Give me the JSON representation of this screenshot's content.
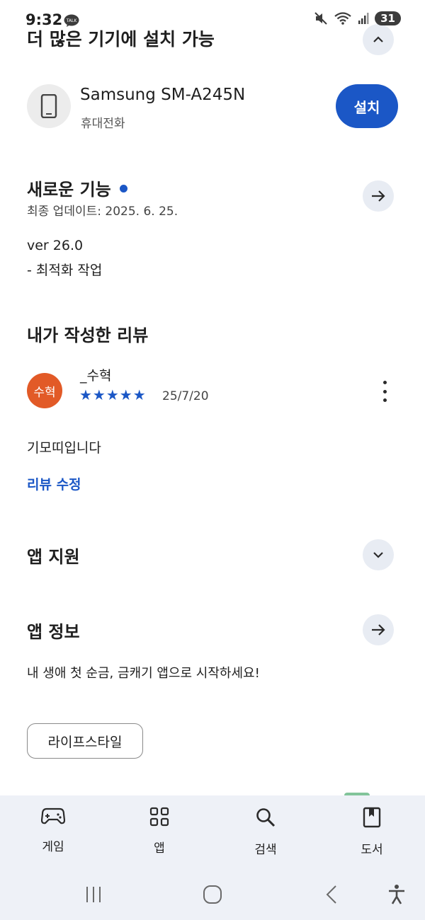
{
  "status_bar": {
    "time": "9:32",
    "talk_badge": "TALK",
    "battery": "31"
  },
  "header": {
    "cut_title": "더 많은 기기에 설치 가능"
  },
  "device": {
    "name": "Samsung SM-A245N",
    "type": "휴대전화",
    "install_label": "설치"
  },
  "whats_new": {
    "title": "새로운 기능",
    "updated": "최종 업데이트: 2025. 6. 25.",
    "version": "ver 26.0",
    "note": "- 최적화 작업"
  },
  "my_review": {
    "title": "내가 작성한 리뷰",
    "avatar_text": "수혁",
    "reviewer": "_수혁",
    "rating": 5,
    "stars": "★★★★★",
    "date": "25/7/20",
    "text": "기모띠입니다",
    "edit_label": "리뷰 수정"
  },
  "app_support": {
    "title": "앱 지원"
  },
  "app_info": {
    "title": "앱 정보",
    "description": "내 생애 첫 순금, 금캐기 앱으로 시작하세요!",
    "category_chip": "라이프스타일"
  },
  "bottom_nav": {
    "items": [
      {
        "label": "게임",
        "icon": "gamepad-icon"
      },
      {
        "label": "앱",
        "icon": "apps-grid-icon"
      },
      {
        "label": "검색",
        "icon": "search-icon"
      },
      {
        "label": "도서",
        "icon": "book-icon"
      }
    ]
  },
  "colors": {
    "accent": "#1b57c6",
    "avatar": "#e25a27",
    "nav_bg": "#eef1f7"
  }
}
